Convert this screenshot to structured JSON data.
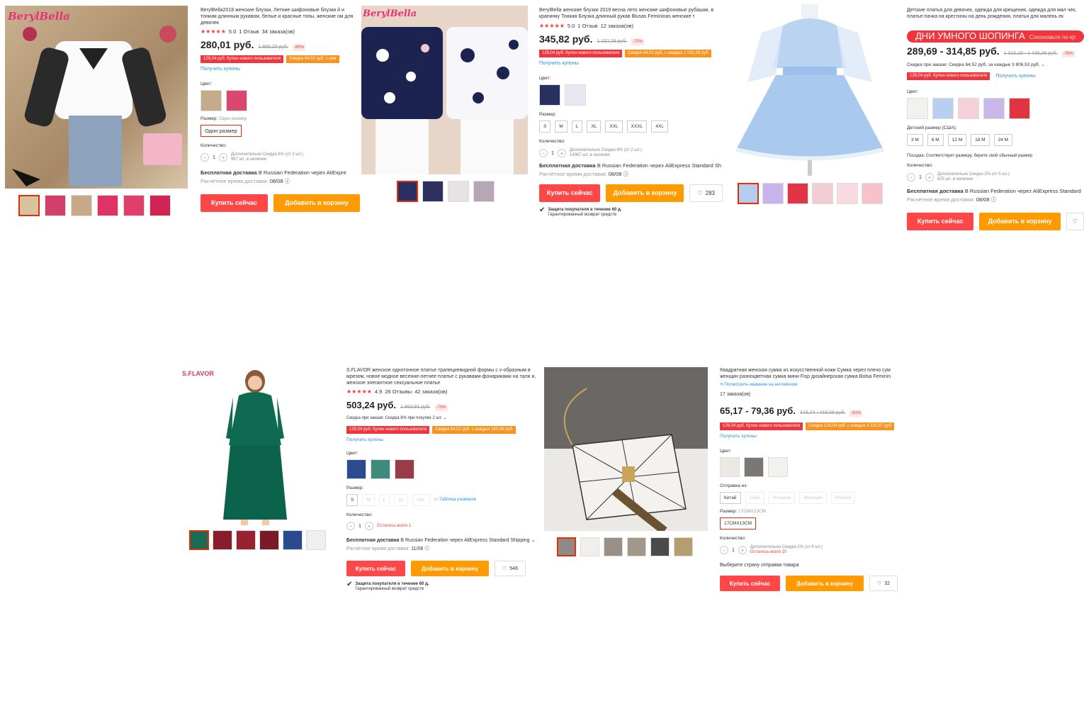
{
  "p1": {
    "brand": "BerylBella",
    "title": "BerylBella2018 женские блузки, Летние шифоновые блузки й и тонким длинным рукавом, белые и красные топы, женские ом для девочек",
    "rating": "5.0",
    "reviews": "1 Отзыв",
    "orders": "34 заказа(ов)",
    "price": "280,01 руб.",
    "old_price": "1 865,20 руб.",
    "discount": "-85%",
    "coupon1": "129,04 руб. Купон нового пользователя",
    "coupon2": "Скидка 64,52 руб. с каж",
    "get_coupons": "Получить купоны",
    "color_label": "Цвет:",
    "size_label": "Размер:",
    "size_value": "Один размер",
    "size_option": "Один размер",
    "qty_label": "Количество:",
    "qty": "1",
    "qty_note1": "Дополнительно Скидка 6% (от 2 шт.)",
    "qty_note2": "987 шт. в наличии",
    "ship_bold": "Бесплатная доставка",
    "ship_rest": " В Russian Federation через AliExpre",
    "eta_label": "Расчётное время доставки: ",
    "eta_date": "08/08",
    "buy": "Купить сейчас",
    "cart": "Добавить в корзину"
  },
  "p2": {
    "brand": "BerylBella",
    "title": "BerylBella женские блузки 2019 весна лето женские шифоновые рубашки, в крапинку Тонкая Блузка длинный рукав Blusas Femininas женские т",
    "rating": "5.0",
    "reviews": "1 Отзыв",
    "orders": "12 заказа(ов)",
    "price": "345,82 руб.",
    "old_price": "1 152,29 руб.",
    "discount": "-70%",
    "coupon1": "129,04 руб. Купон нового пользователя",
    "coupon2": "Скидка 64,52 руб. с каждых 1 032,28 руб",
    "get_coupons": "Получить купоны",
    "color_label": "Цвет:",
    "size_label": "Размер:",
    "sizes": [
      "S",
      "M",
      "L",
      "XL",
      "XXL",
      "XXXL",
      "4XL"
    ],
    "qty_label": "Количество:",
    "qty": "1",
    "qty_note1": "Дополнительно Скидка 8% (от 2 шт.)",
    "qty_note2": "14067 шт. в наличии",
    "ship_bold": "Бесплатная доставка",
    "ship_rest": " В Russian Federation через AliExpress Standard Sh",
    "eta_label": "Расчётное время доставки: ",
    "eta_date": "08/08",
    "buy": "Купить сейчас",
    "cart": "Добавить в корзину",
    "likes": "283",
    "prot1": "Защита покупателя в течение 60 д.",
    "prot2": "Гарантированный возврат средств"
  },
  "p3": {
    "title": "Детские платья для девочек, одежда для крещения, одежда для мал чек, платье-пачка на крестины на день рождения, платья для малень ек",
    "banner": "ДНИ УМНОГО ШОПИНГА",
    "banner_sub": "Сэкономьте по-кр",
    "price": "289,69 - 314,85 руб.",
    "old_price": "1 316,16 - 1 430,36 руб.",
    "discount": "-78%",
    "order_disc": "Скидка при заказе: Скидка 64,52 руб. за каждые 3 806,53 руб. ⌄",
    "coupon1": "129,04 руб. Купон нового пользователя",
    "get_coupons": "Получить купоны",
    "color_label": "Цвет:",
    "size_label": "Детский размер (США):",
    "sizes": [
      "3 M",
      "6 M",
      "12 M",
      "18 M",
      "24 M"
    ],
    "fit": "Посадка: Соответствует размеру, берите свой обычный размер",
    "qty_label": "Количество:",
    "qty": "1",
    "qty_note1": "Дополнительно Скидка 2% (от 5 шт.)",
    "qty_note2": "825 шт. в наличии",
    "ship_bold": "Бесплатная доставка",
    "ship_rest": " В Russian Federation через AliExpress Standard",
    "eta_label": "Расчётное время доставки: ",
    "eta_date": "08/08",
    "buy": "Купить сейчас",
    "cart": "Добавить в корзину"
  },
  "p4": {
    "brand": "S.FLAVOR",
    "title": "S.FLAVOR женское однотонное платье трапециевидной формы с v-образным в мрезом, новое модное весенне-летнее платье с рукавами-фонариками на тали и, женское элегантное сексуальное платье",
    "rating": "4.9",
    "reviews": "26 Отзывы",
    "orders": "42 заказа(ов)",
    "price": "503,24 руб.",
    "old_price": "1 863,91 руб.",
    "discount": "-73%",
    "order_disc": "Скидка при заказе: Скидка 8% при покупке 2 шт. ⌄",
    "coupon1": "129,04 руб. Купон нового пользователя",
    "coupon2": "Скидка 64,52 руб. с каждых 193,56 руб.",
    "get_coupons": "Получить купоны",
    "color_label": "Цвет:",
    "size_label": "Размер:",
    "sizes": [
      "S",
      "M",
      "L",
      "XL",
      "XXL"
    ],
    "size_table": "Таблица размеров",
    "qty_label": "Количество:",
    "qty": "1",
    "qty_note1": "Осталось всего 1",
    "ship_bold": "Бесплатная доставка",
    "ship_rest": " В Russian Federation через AliExpress Standard Shipping ⌄",
    "eta_label": "Расчётное время доставки: ",
    "eta_date": "11/08",
    "buy": "Купить сейчас",
    "cart": "Добавить в корзину",
    "likes": "546",
    "prot1": "Защита покупателя в течение 60 д.",
    "prot2": "Гарантированный возврат средств"
  },
  "p5": {
    "title": "Квадратная женская сумка из искусственной кожи Сумка через плечо сум женщин разноцветная сумка мини Fisp дизайнерская сумка Bolsa Feminin",
    "translate": "Посмотреть название на английском",
    "orders": "17 заказа(ов)",
    "price": "65,17 - 79,36 руб.",
    "old_price": "343,24 - 418,08 руб.",
    "discount": "-81%",
    "coupon1": "129,04 руб. Купон нового пользователя",
    "coupon2": "Скидка 129,04 руб. с каждых 3 225,87 руб",
    "get_coupons": "Получить купоны",
    "color_label": "Цвет:",
    "ship_from_label": "Отправка из:",
    "ship_from": [
      "Китай",
      "США",
      "Испания",
      "Франция",
      "Италия"
    ],
    "size_label": "Размер:",
    "size_value": "17CMX13CM",
    "size_option": "17CMX13CM",
    "qty_label": "Количество:",
    "qty": "1",
    "qty_note1": "Дополнительно Скидка 2% (от 8 шт.)",
    "qty_note2": "Осталось всего 10",
    "choose_country": "Выберите страну отправки товара",
    "buy": "Купить сейчас",
    "cart": "Добавить в корзину",
    "likes": "32"
  },
  "colors": {
    "accent_red": "#ff4747",
    "accent_orange": "#ff9a00",
    "link_blue": "#2b8ee6"
  }
}
